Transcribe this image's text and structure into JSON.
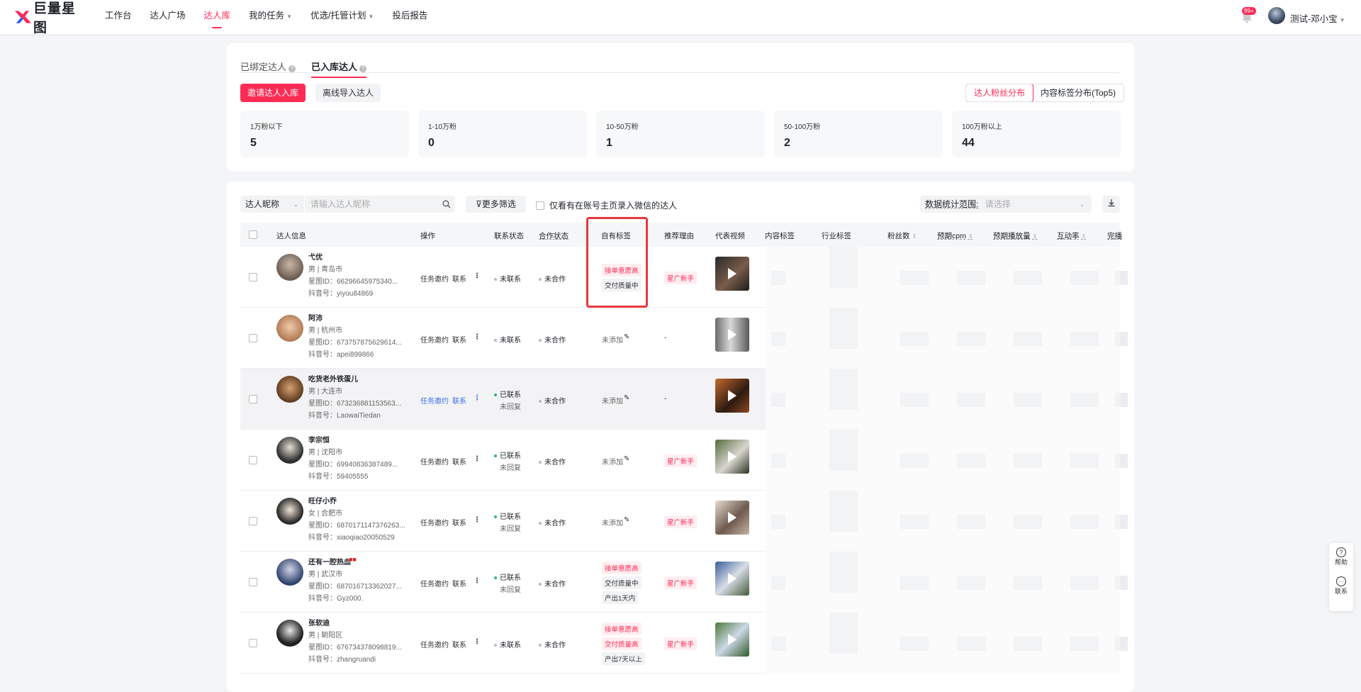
{
  "brand": {
    "name": "巨量星图"
  },
  "nav": [
    {
      "label": "工作台"
    },
    {
      "label": "达人广场"
    },
    {
      "label": "达人库"
    },
    {
      "label": "我的任务"
    },
    {
      "label": "优选/托管计划"
    },
    {
      "label": "投后报告"
    }
  ],
  "header": {
    "badge": "99+",
    "username": "测试-邓小宝"
  },
  "tabs": [
    {
      "label": "已绑定达人"
    },
    {
      "label": "已入库达人"
    }
  ],
  "buttons": {
    "invite": "邀请达人入库",
    "offline": "离线导入达人"
  },
  "segments": [
    {
      "label": "达人粉丝分布"
    },
    {
      "label": "内容标签分布(Top5)"
    }
  ],
  "stats": [
    {
      "label": "1万粉以下",
      "value": "5"
    },
    {
      "label": "1-10万粉",
      "value": "0"
    },
    {
      "label": "10-50万粉",
      "value": "1"
    },
    {
      "label": "50-100万粉",
      "value": "2"
    },
    {
      "label": "100万粉以上",
      "value": "44"
    }
  ],
  "filter": {
    "select": "达人昵称",
    "placeholder": "请输入达人昵称",
    "more": "更多筛选",
    "wechat": "仅看有在账号主页录入微信的达人",
    "range_label": "数据统计范围:",
    "range_placeholder": "请选择"
  },
  "columns": {
    "info": "达人信息",
    "ops": "操作",
    "contact": "联系状态",
    "coop": "合作状态",
    "tags": "自有标签",
    "reason": "推荐理由",
    "video": "代表视频",
    "content": "内容标签",
    "industry": "行业标签",
    "fans": "粉丝数",
    "cpm": "预期cpm",
    "play": "预期播放量",
    "interact": "互动率",
    "finish": "完播"
  },
  "rows": [
    {
      "name": "弋优",
      "meta": "男 | 青岛市",
      "star": "星图ID：66296645975340...",
      "dy": "抖音号：yiyou84869",
      "task": "任务邀约",
      "link": "联系",
      "contact": "未联系",
      "contact2": "",
      "coop": "未合作",
      "tags": [
        "接单意愿高",
        "交付质量中"
      ],
      "notag": "",
      "reason": "星广新手"
    },
    {
      "name": "阿沛",
      "meta": "男 | 杭州市",
      "star": "星图ID：673757875629614...",
      "dy": "抖音号：apei899866",
      "task": "任务邀约",
      "link": "联系",
      "contact": "未联系",
      "contact2": "",
      "coop": "未合作",
      "tags": [],
      "notag": "未添加",
      "reason": "-"
    },
    {
      "name": "吃货老外铁蛋儿",
      "meta": "男 | 大连市",
      "star": "星图ID：673236881153563...",
      "dy": "抖音号：LaowaiTiedan",
      "task": "任务邀约",
      "link": "联系",
      "contact": "已联系",
      "contact2": "未回复",
      "coop": "未合作",
      "tags": [],
      "notag": "未添加",
      "reason": "-"
    },
    {
      "name": "李宗恒",
      "meta": "男 | 沈阳市",
      "star": "星图ID：69940836387489...",
      "dy": "抖音号：59405555",
      "task": "任务邀约",
      "link": "联系",
      "contact": "已联系",
      "contact2": "未回复",
      "coop": "未合作",
      "tags": [],
      "notag": "未添加",
      "reason": "星广新手"
    },
    {
      "name": "旺仔小乔",
      "meta": "女 | 合肥市",
      "star": "星图ID：6870171147376263...",
      "dy": "抖音号：xiaoqiao20050529",
      "task": "任务邀约",
      "link": "联系",
      "contact": "已联系",
      "contact2": "未回复",
      "coop": "未合作",
      "tags": [],
      "notag": "未添加",
      "reason": "星广新手"
    },
    {
      "name": "还有一腔热血",
      "meta": "男 | 武汉市",
      "star": "星图ID：687016713362027...",
      "dy": "抖音号：Gyz000.",
      "task": "任务邀约",
      "link": "联系",
      "contact": "已联系",
      "contact2": "未回复",
      "coop": "未合作",
      "tags": [
        "接单意愿高",
        "交付质量中",
        "产出1天内"
      ],
      "notag": "",
      "reason": "星广新手"
    },
    {
      "name": "张软迪",
      "meta": "男 | 朝阳区",
      "star": "星图ID：676734378098819...",
      "dy": "抖音号：zhangruandi",
      "task": "任务邀约",
      "link": "联系",
      "contact": "未联系",
      "contact2": "",
      "coop": "未合作",
      "tags": [
        "接单意愿高",
        "交付质量高",
        "产出7天以上"
      ],
      "notag": "",
      "reason": "星广新手"
    }
  ],
  "side": {
    "help": "帮助",
    "contact": "联系"
  }
}
